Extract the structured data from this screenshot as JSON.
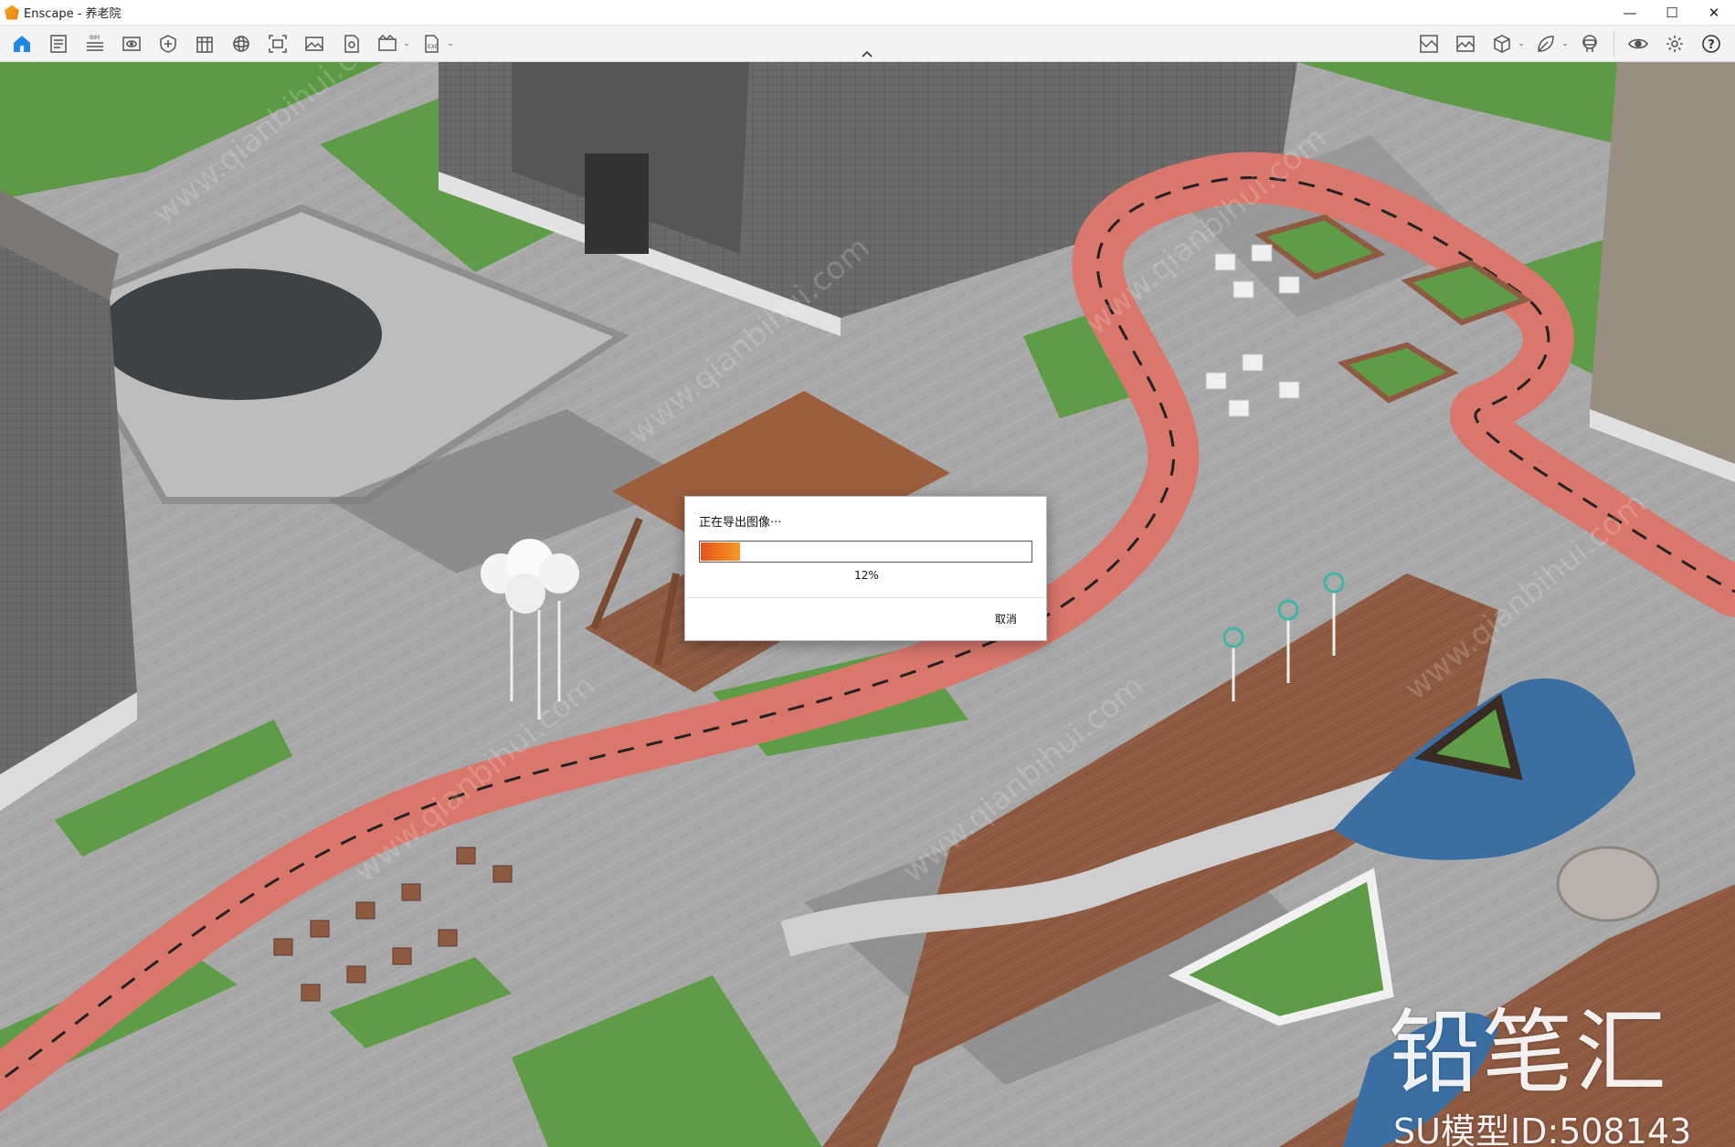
{
  "window": {
    "title": "Enscape - 养老院",
    "minimize": "—",
    "maximize": "☐",
    "close": "✕"
  },
  "toolbar": {
    "left_icons": [
      "home-icon",
      "document-icon",
      "bim-icon",
      "eye-icon",
      "shield-icon",
      "building-icon",
      "sphere-icon",
      "screenshot-icon",
      "image-icon",
      "panorama-icon",
      "video-icon",
      "export-icon"
    ],
    "right_icons": [
      "map-icon",
      "gallery-icon",
      "cube-icon",
      "leaf-icon",
      "vr-icon",
      "visibility-icon",
      "settings-icon",
      "help-icon"
    ],
    "help_label": "?"
  },
  "dialog": {
    "title": "正在导出图像···",
    "progress_percent": 12,
    "progress_label": "12%",
    "cancel_label": "取消"
  },
  "watermark": {
    "brand": "铅笔汇",
    "id_text": "SU模型ID:508143"
  },
  "colors": {
    "accent": "#1e88e5",
    "track": "#d9776c",
    "grass": "#5d9a46",
    "pavement": "#a9a9a9",
    "deck": "#8e5b42",
    "water": "#3b6fa3",
    "progress": "#f07d1c"
  }
}
